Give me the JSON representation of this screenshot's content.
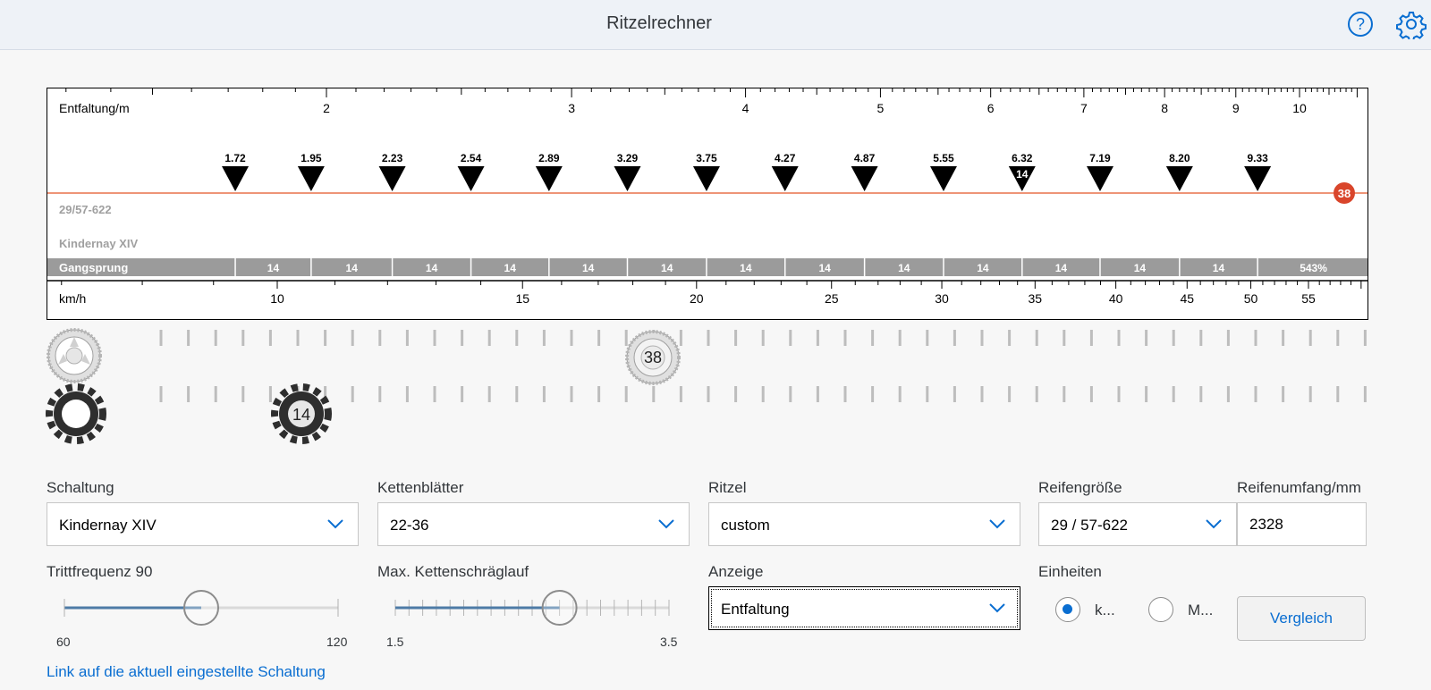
{
  "header": {
    "title": "Ritzelrechner",
    "help_icon": "help-icon",
    "settings_icon": "gear-icon"
  },
  "chart": {
    "top_axis_label": "Entfaltung/m",
    "top_ticks": [
      {
        "v": 2,
        "label": "2"
      },
      {
        "v": 3,
        "label": "3"
      },
      {
        "v": 4,
        "label": "4"
      },
      {
        "v": 5,
        "label": "5"
      },
      {
        "v": 6,
        "label": "6"
      },
      {
        "v": 7,
        "label": "7"
      },
      {
        "v": 8,
        "label": "8"
      },
      {
        "v": 9,
        "label": "9"
      },
      {
        "v": 10,
        "label": "10"
      }
    ],
    "gear_values": [
      "1.72",
      "1.95",
      "2.23",
      "2.54",
      "2.89",
      "3.29",
      "3.75",
      "4.27",
      "4.87",
      "5.55",
      "6.32",
      "7.19",
      "8.20",
      "9.33"
    ],
    "active_sprocket_label": "14",
    "chainring_badge": "38",
    "tire_label": "29/57-622",
    "shifter_label": "Kindernay XIV",
    "steps_label": "Gangsprung",
    "steps": [
      "14",
      "14",
      "14",
      "14",
      "14",
      "14",
      "14",
      "14",
      "14",
      "14",
      "14",
      "14",
      "14"
    ],
    "range": "543%",
    "bottom_axis_label": "km/h",
    "bottom_ticks": [
      {
        "v": 10,
        "label": "10"
      },
      {
        "v": 15,
        "label": "15"
      },
      {
        "v": 20,
        "label": "20"
      },
      {
        "v": 25,
        "label": "25"
      },
      {
        "v": 30,
        "label": "30"
      },
      {
        "v": 35,
        "label": "35"
      },
      {
        "v": 40,
        "label": "40"
      },
      {
        "v": 45,
        "label": "45"
      },
      {
        "v": 50,
        "label": "50"
      },
      {
        "v": 55,
        "label": "55"
      }
    ],
    "colors": {
      "line": "#e8704a",
      "badge": "#d9452b",
      "band": "#9b9b9b"
    }
  },
  "gears": {
    "chainring_selected": "38",
    "sprocket_selected": "14",
    "chainring_icon": "chainring-icon",
    "sprocket_icon": "sprocket-icon"
  },
  "form": {
    "schaltung": {
      "label": "Schaltung",
      "value": "Kindernay XIV"
    },
    "kettenblaetter": {
      "label": "Kettenblätter",
      "value": "22-36"
    },
    "ritzel": {
      "label": "Ritzel",
      "value": "custom"
    },
    "reifengroesse": {
      "label": "Reifengröße",
      "value": "29 / 57-622"
    },
    "reifenumfang": {
      "label": "Reifenumfang/mm",
      "value": "2328"
    },
    "trittfrequenz": {
      "label": "Trittfrequenz 90",
      "min": "60",
      "max": "120",
      "value": 90,
      "min_value": 60,
      "max_value": 120
    },
    "kettenschraeglauf": {
      "label": "Max. Kettenschräglauf",
      "min": "1.5",
      "max": "3.5",
      "value": 2.7,
      "min_value": 1.5,
      "max_value": 3.5
    },
    "anzeige": {
      "label": "Anzeige",
      "value": "Entfaltung"
    },
    "einheiten": {
      "label": "Einheiten",
      "option1": "k...",
      "option2": "M...",
      "selected": 1
    },
    "compare_button": "Vergleich",
    "link": "Link auf die aktuell eingestellte Schaltung"
  }
}
